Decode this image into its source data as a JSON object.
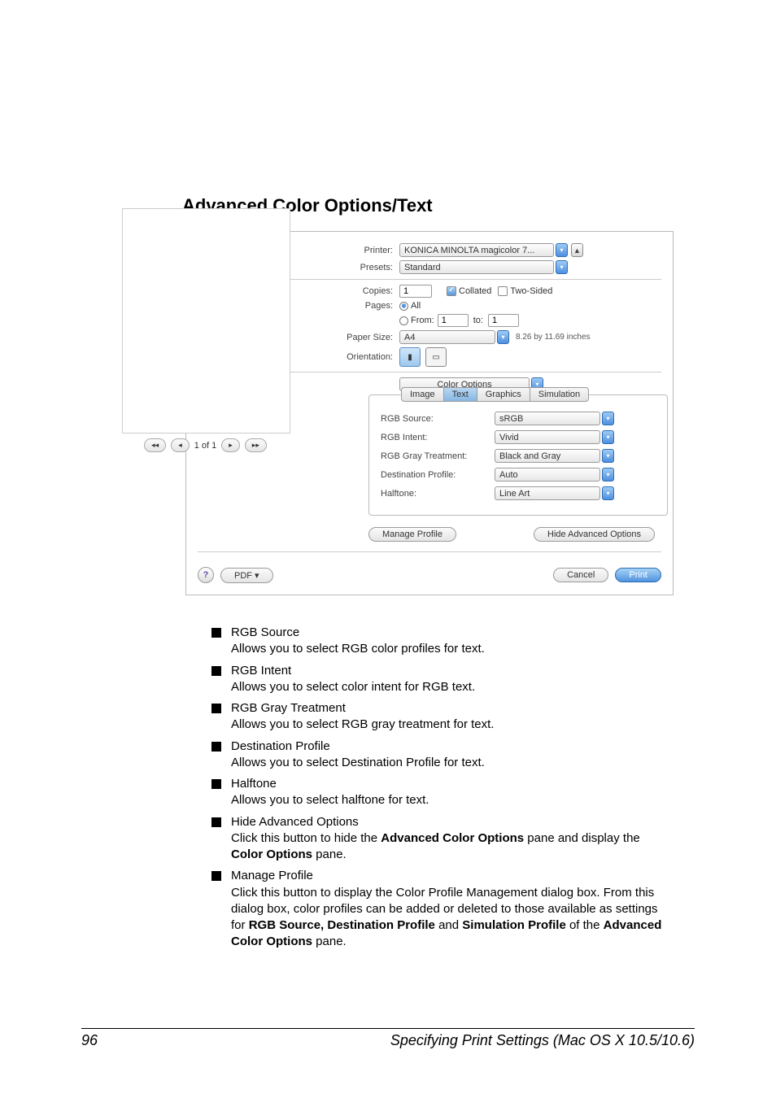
{
  "heading": "Advanced Color Options/Text",
  "dialog": {
    "printer_lbl": "Printer:",
    "printer_val": "KONICA MINOLTA magicolor 7...",
    "presets_lbl": "Presets:",
    "presets_val": "Standard",
    "copies_lbl": "Copies:",
    "copies_val": "1",
    "collated": "Collated",
    "twosided": "Two-Sided",
    "pages_lbl": "Pages:",
    "all": "All",
    "from": "From:",
    "from_val": "1",
    "to": "to:",
    "to_val": "1",
    "paper_lbl": "Paper Size:",
    "paper_val": "A4",
    "paper_dim": "8.26 by 11.69 inches",
    "orient_lbl": "Orientation:",
    "section_val": "Color Options",
    "tabs": {
      "image": "Image",
      "text": "Text",
      "graphics": "Graphics",
      "sim": "Simulation"
    },
    "rows": [
      {
        "l": "RGB Source:",
        "v": "sRGB"
      },
      {
        "l": "RGB Intent:",
        "v": "Vivid"
      },
      {
        "l": "RGB Gray Treatment:",
        "v": "Black and Gray"
      },
      {
        "l": "Destination Profile:",
        "v": "Auto"
      },
      {
        "l": "Halftone:",
        "v": "Line Art"
      }
    ],
    "manage": "Manage Profile",
    "hide": "Hide Advanced Options",
    "pdf": "PDF ▾",
    "cancel": "Cancel",
    "print": "Print",
    "pager": "1 of 1"
  },
  "items": [
    {
      "t": "RGB Source",
      "d": "Allows you to select RGB color profiles for text."
    },
    {
      "t": "RGB Intent",
      "d": "Allows you to select color intent for RGB text."
    },
    {
      "t": "RGB Gray Treatment",
      "d": "Allows you to select RGB gray treatment for text."
    },
    {
      "t": "Destination Profile",
      "d": "Allows you to select Destination Profile for text."
    },
    {
      "t": "Halftone",
      "d": "Allows you to select halftone for text."
    },
    {
      "t": "Hide Advanced Options",
      "d": "Click this button to hide the <b>Advanced Color Options</b> pane and display the <b>Color Options</b> pane."
    },
    {
      "t": "Manage Profile",
      "d": "Click this button to display the Color Profile Management dialog box. From this dialog box, color profiles can be added or deleted to those available as settings for <b>RGB Source, Destination Profile</b> and <b>Simulation Profile</b> of the <b>Advanced Color Options</b> pane."
    }
  ],
  "footer": {
    "page": "96",
    "title": "Specifying Print Settings (Mac OS X 10.5/10.6)"
  }
}
